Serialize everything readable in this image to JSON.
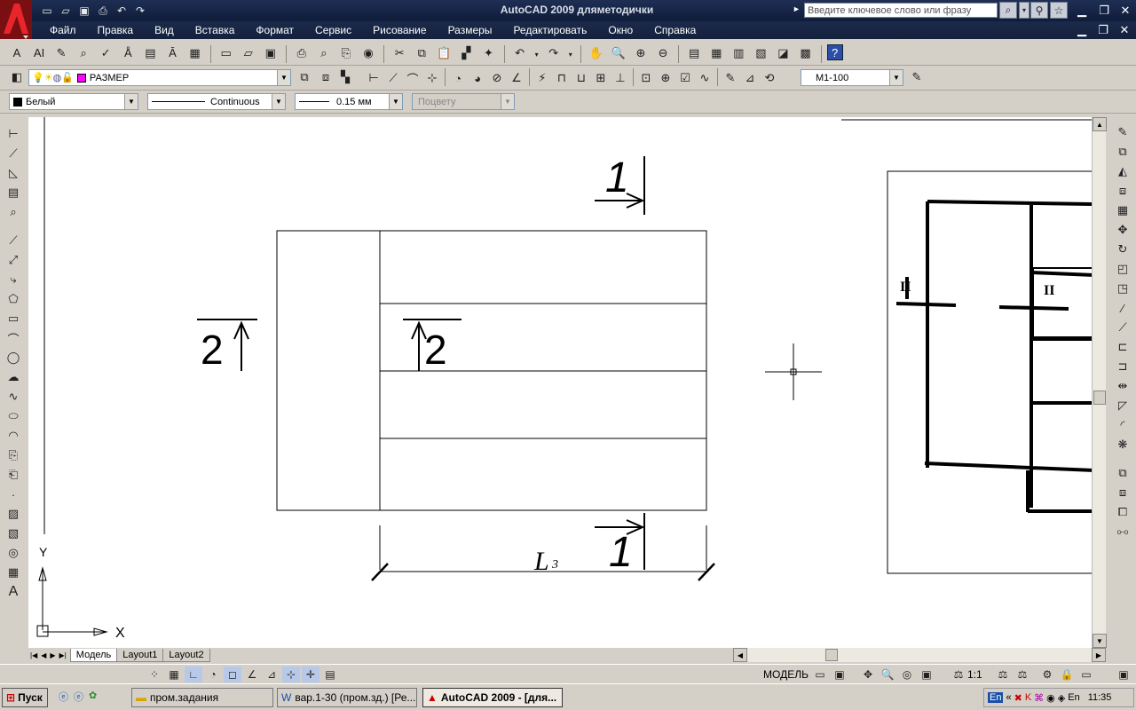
{
  "window": {
    "title": "AutoCAD 2009 дляметодички",
    "search_placeholder": "Введите ключевое слово или фразу"
  },
  "menu": [
    "Файл",
    "Правка",
    "Вид",
    "Вставка",
    "Формат",
    "Сервис",
    "Рисование",
    "Размеры",
    "Редактировать",
    "Окно",
    "Справка"
  ],
  "layers": {
    "current_layer": "РАЗМЕР",
    "scale": "M1-100",
    "color": "Белый",
    "linetype": "Continuous",
    "lineweight": "0.15 мм",
    "plotstyle": "Поцвету"
  },
  "drawing": {
    "section_1": "1",
    "section_2": "2",
    "dim_label_L": "L",
    "dim_label_sub": "3",
    "ucs_x": "X",
    "ucs_y": "Y",
    "inset_label_1": "II",
    "inset_label_2": "II"
  },
  "tabs": [
    "Модель",
    "Layout1",
    "Layout2"
  ],
  "status": {
    "model_label": "МОДЕЛЬ",
    "scale_label": "1:1"
  },
  "taskbar": {
    "start": "Пуск",
    "tasks": [
      "пром.задания",
      "вар.1-30 (пром.зд.) [Ре...",
      "AutoCAD 2009 - [для..."
    ],
    "lang": "En",
    "lang2": "En",
    "clock": "11:35"
  },
  "colors": {
    "title_bg": "#14213d",
    "layer_swatch": "#ff00ff",
    "bulb": "#ffee00"
  }
}
